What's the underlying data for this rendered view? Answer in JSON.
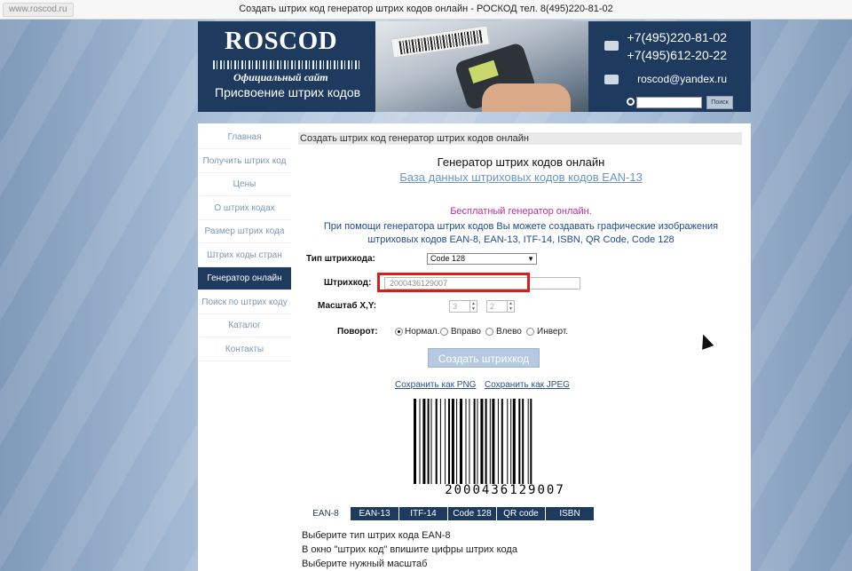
{
  "browser": {
    "url": "www.roscod.ru",
    "title": "Создать штрих код генератор штрих кодов онлайн - РОСКОД тел. 8(495)220-81-02"
  },
  "header": {
    "logo": "ROSCOD",
    "official": "Официальный сайт",
    "tagline": "Присвоение штрих кодов",
    "phone1": "+7(495)220-81-02",
    "phone2": "+7(495)612-20-22",
    "email": "roscod@yandex.ru",
    "search_button": "Поиск"
  },
  "sidebar": {
    "items": [
      {
        "label": "Главная"
      },
      {
        "label": "Получить штрих код"
      },
      {
        "label": "Цены"
      },
      {
        "label": "О штрих кодах"
      },
      {
        "label": "Размер штрих кода"
      },
      {
        "label": "Штрих коды стран"
      },
      {
        "label": "Генератор онлайн"
      },
      {
        "label": "Поиск по штрих коду"
      },
      {
        "label": "Каталог"
      },
      {
        "label": "Контакты"
      }
    ]
  },
  "content": {
    "breadcrumb": "Создать штрих код генератор штрих кодов онлайн",
    "heading": "Генератор штрих кодов онлайн",
    "db_link": "База данных штриховых кодов кодов EAN-13",
    "free": "Бесплатный генератор онлайн.",
    "desc": "При помощи генератора штрих кодов Вы можете создавать графические изображения штриховых кодов EAN-8, EAN-13, ITF-14, ISBN, QR Code, Code 128",
    "form": {
      "type_label": "Тип штрихкода:",
      "type_value": "Code 128",
      "code_label": "Штрихкод:",
      "code_value": "2000436129007",
      "scale_label": "Масштаб X,Y:",
      "scale_x": "3",
      "scale_y": "2",
      "rotate_label": "Поворот:",
      "rotations": [
        "Нормал.",
        "Вправо",
        "Влево",
        "Инверт."
      ],
      "create_button": "Создать штрихкод"
    },
    "save_png": "Сохранить как PNG",
    "save_jpeg": "Сохранить как JPEG",
    "barcode_number": "2000436129007",
    "tabs": [
      "EAN-8",
      "EAN-13",
      "ITF-14",
      "Code 128",
      "QR code",
      "ISBN"
    ],
    "instructions": [
      "Выберите тип штрих кода  EAN-8",
      "В окно \"штрих код\" впишите цифры штрих кода",
      "Выберите нужный масштаб"
    ]
  }
}
